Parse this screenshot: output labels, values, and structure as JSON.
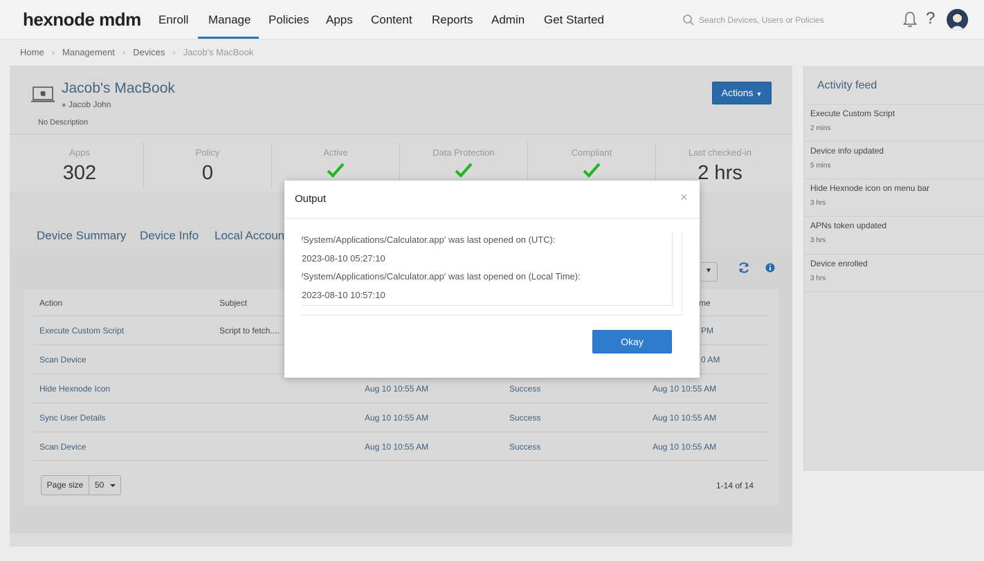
{
  "brand": {
    "logo": "hexnode mdm"
  },
  "nav": {
    "items": [
      "Enroll",
      "Manage",
      "Policies",
      "Apps",
      "Content",
      "Reports",
      "Admin",
      "Get Started"
    ],
    "active": "Manage"
  },
  "search": {
    "placeholder": "Search Devices, Users or Policies"
  },
  "breadcrumb": [
    "Home",
    "Management",
    "Devices",
    "Jacob's MacBook"
  ],
  "device": {
    "name": "Jacob's MacBook",
    "user": "Jacob John",
    "description": "No Description",
    "actions_label": "Actions"
  },
  "stats": [
    {
      "label": "Apps",
      "value": "302"
    },
    {
      "label": "Policy",
      "value": "0"
    },
    {
      "label": "Active",
      "value": "check"
    },
    {
      "label": "Data Protection",
      "value": "check"
    },
    {
      "label": "Compliant",
      "value": "check"
    },
    {
      "label": "Last checked-in",
      "value": "2 hrs"
    }
  ],
  "tabs": [
    "Device Summary",
    "Device Info",
    "Local Accounts"
  ],
  "table": {
    "columns": [
      "Action",
      "Subject",
      "me"
    ],
    "rows": [
      {
        "action": "Execute Custom Script",
        "subject": "Script to fetch....",
        "time1": "",
        "status": "",
        "time2": "PM"
      },
      {
        "action": "Scan Device",
        "subject": "",
        "time1": "",
        "status": "",
        "time2": "0 AM"
      },
      {
        "action": "Hide Hexnode Icon",
        "subject": "",
        "time1": "Aug 10 10:55 AM",
        "status": "Success",
        "time2": "Aug 10 10:55 AM"
      },
      {
        "action": "Sync User Details",
        "subject": "",
        "time1": "Aug 10 10:55 AM",
        "status": "Success",
        "time2": "Aug 10 10:55 AM"
      },
      {
        "action": "Scan Device",
        "subject": "",
        "time1": "Aug 10 10:55 AM",
        "status": "Success",
        "time2": "Aug 10 10:55 AM"
      }
    ],
    "page_size_label": "Page size",
    "page_size_value": "50",
    "pagination": "1-14 of 14"
  },
  "activity_feed": {
    "title": "Activity feed",
    "items": [
      {
        "text": "Execute Custom Script",
        "time": "2 mins"
      },
      {
        "text": "Device info updated",
        "time": "5 mins"
      },
      {
        "text": "Hide Hexnode icon on menu bar",
        "time": "3 hrs"
      },
      {
        "text": "APNs token updated",
        "time": "3 hrs"
      },
      {
        "text": "Device enrolled",
        "time": "3 hrs"
      }
    ]
  },
  "modal": {
    "title": "Output",
    "close": "×",
    "lines": [
      "'/System/Applications/Calculator.app' was last opened on (UTC):",
      "2023-08-10 05:27:10",
      "'/System/Applications/Calculator.app' was last opened on (Local Time):",
      "2023-08-10 10:57:10"
    ],
    "ok_label": "Okay"
  },
  "colors": {
    "accent": "#2f7ccc",
    "success": "#22b522",
    "link": "#3e5e7c"
  }
}
